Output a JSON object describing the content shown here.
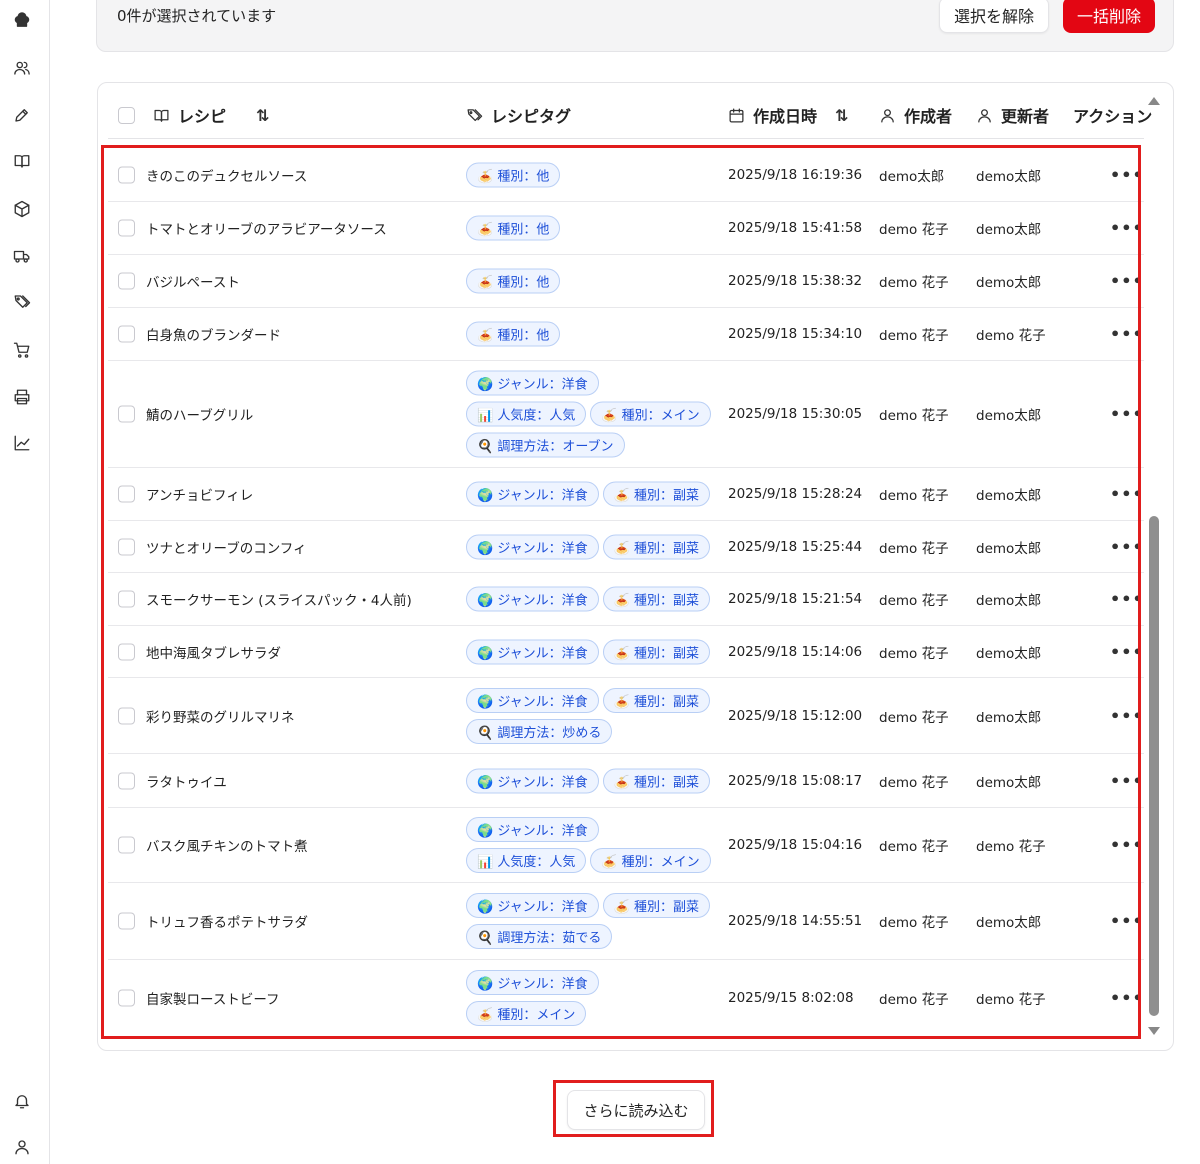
{
  "selection": {
    "count_text": "0件が選択されています",
    "clear_label": "選択を解除",
    "bulk_delete_label": "一括削除"
  },
  "table": {
    "headers": {
      "recipe": "レシピ",
      "tags": "レシピタグ",
      "created_at": "作成日時",
      "creator": "作成者",
      "updater": "更新者",
      "action": "アクション"
    },
    "rows": [
      {
        "name": "きのこのデュクセルソース",
        "tags": [
          [
            "🍝 種別：他"
          ]
        ],
        "date": "2025/9/18 16:19:36",
        "creator": "demo太郎",
        "updater": "demo太郎"
      },
      {
        "name": "トマトとオリーブのアラビアータソース",
        "tags": [
          [
            "🍝 種別：他"
          ]
        ],
        "date": "2025/9/18 15:41:58",
        "creator": "demo 花子",
        "updater": "demo太郎"
      },
      {
        "name": "バジルペースト",
        "tags": [
          [
            "🍝 種別：他"
          ]
        ],
        "date": "2025/9/18 15:38:32",
        "creator": "demo 花子",
        "updater": "demo太郎"
      },
      {
        "name": "白身魚のブランダード",
        "tags": [
          [
            "🍝 種別：他"
          ]
        ],
        "date": "2025/9/18 15:34:10",
        "creator": "demo 花子",
        "updater": "demo 花子"
      },
      {
        "name": "鯖のハーブグリル",
        "tags": [
          [
            "🌍 ジャンル：洋食"
          ],
          [
            "📊 人気度：人気",
            "🍝 種別：メイン"
          ],
          [
            "🍳 調理方法：オーブン"
          ]
        ],
        "date": "2025/9/18 15:30:05",
        "creator": "demo 花子",
        "updater": "demo太郎"
      },
      {
        "name": "アンチョビフィレ",
        "tags": [
          [
            "🌍 ジャンル：洋食",
            "🍝 種別：副菜"
          ]
        ],
        "date": "2025/9/18 15:28:24",
        "creator": "demo 花子",
        "updater": "demo太郎"
      },
      {
        "name": "ツナとオリーブのコンフィ",
        "tags": [
          [
            "🌍 ジャンル：洋食",
            "🍝 種別：副菜"
          ]
        ],
        "date": "2025/9/18 15:25:44",
        "creator": "demo 花子",
        "updater": "demo太郎"
      },
      {
        "name": "スモークサーモン (スライスパック・4人前)",
        "tags": [
          [
            "🌍 ジャンル：洋食",
            "🍝 種別：副菜"
          ]
        ],
        "date": "2025/9/18 15:21:54",
        "creator": "demo 花子",
        "updater": "demo太郎"
      },
      {
        "name": "地中海風タブレサラダ",
        "tags": [
          [
            "🌍 ジャンル：洋食",
            "🍝 種別：副菜"
          ]
        ],
        "date": "2025/9/18 15:14:06",
        "creator": "demo 花子",
        "updater": "demo太郎"
      },
      {
        "name": "彩り野菜のグリルマリネ",
        "tags": [
          [
            "🌍 ジャンル：洋食",
            "🍝 種別：副菜"
          ],
          [
            "🍳 調理方法：炒める"
          ]
        ],
        "date": "2025/9/18 15:12:00",
        "creator": "demo 花子",
        "updater": "demo太郎"
      },
      {
        "name": "ラタトゥイユ",
        "tags": [
          [
            "🌍 ジャンル：洋食",
            "🍝 種別：副菜"
          ]
        ],
        "date": "2025/9/18 15:08:17",
        "creator": "demo 花子",
        "updater": "demo太郎"
      },
      {
        "name": "バスク風チキンのトマト煮",
        "tags": [
          [
            "🌍 ジャンル：洋食"
          ],
          [
            "📊 人気度：人気",
            "🍝 種別：メイン"
          ]
        ],
        "date": "2025/9/18 15:04:16",
        "creator": "demo 花子",
        "updater": "demo 花子"
      },
      {
        "name": "トリュフ香るポテトサラダ",
        "tags": [
          [
            "🌍 ジャンル：洋食",
            "🍝 種別：副菜"
          ],
          [
            "🍳 調理方法：茹でる"
          ]
        ],
        "date": "2025/9/18 14:55:51",
        "creator": "demo 花子",
        "updater": "demo太郎"
      },
      {
        "name": "自家製ローストビーフ",
        "tags": [
          [
            "🌍 ジャンル：洋食"
          ],
          [
            "🍝 種別：メイン"
          ]
        ],
        "date": "2025/9/15 8:02:08",
        "creator": "demo 花子",
        "updater": "demo 花子"
      }
    ],
    "action_glyph": "•••"
  },
  "load_more_label": "さらに読み込む",
  "sidebar_icons": [
    "chef-hat-icon",
    "users-icon",
    "pencil-icon",
    "book-icon",
    "box-icon",
    "truck-icon",
    "tags-icon",
    "cart-icon",
    "printer-icon",
    "chart-icon",
    "bell-icon",
    "user-icon"
  ],
  "colors": {
    "accent_red": "#e30613",
    "tag_bg": "#eef4ff",
    "tag_border": "#b9cff5",
    "tag_text": "#1d4fd8",
    "highlight": "#e11d1d"
  }
}
